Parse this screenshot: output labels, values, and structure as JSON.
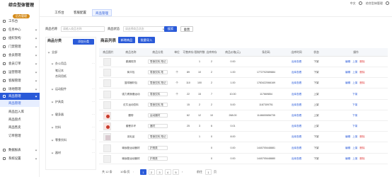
{
  "app": {
    "title": "综合型体管理",
    "badge": "后台管理"
  },
  "sidebar": {
    "items": [
      {
        "label": "工作台",
        "active": false,
        "sub": false,
        "arrow": false
      },
      {
        "label": "任务中心",
        "active": false,
        "sub": false,
        "arrow": true
      },
      {
        "label": "组织架构",
        "active": false,
        "sub": false,
        "arrow": true
      },
      {
        "label": "门禁管理",
        "active": false,
        "sub": false,
        "arrow": true
      },
      {
        "label": "会员管理",
        "active": false,
        "sub": false,
        "arrow": true
      },
      {
        "label": "会员订单",
        "active": false,
        "sub": false,
        "arrow": true
      },
      {
        "label": "运营管理",
        "active": false,
        "sub": false,
        "arrow": true
      },
      {
        "label": "客服管理",
        "active": false,
        "sub": false,
        "arrow": true
      },
      {
        "label": "场地管理",
        "active": false,
        "sub": false,
        "arrow": true
      },
      {
        "label": "商品管理",
        "active": true,
        "sub": false,
        "arrow": true
      },
      {
        "label": "商品管理",
        "active": false,
        "sub": true,
        "arrow": false
      },
      {
        "label": "商品出入库",
        "active": false,
        "sub": false,
        "arrow": false
      },
      {
        "label": "商品盘点",
        "active": false,
        "sub": false,
        "arrow": false
      },
      {
        "label": "商品售卖",
        "active": false,
        "sub": false,
        "arrow": false
      },
      {
        "label": "订单管理",
        "active": false,
        "sub": false,
        "arrow": false
      },
      {
        "label": "数据报表",
        "active": false,
        "sub": false,
        "arrow": true
      },
      {
        "label": "系统设置",
        "active": false,
        "sub": false,
        "arrow": true
      }
    ]
  },
  "topbar": {
    "tabs": [
      {
        "label": "工作台",
        "active": false
      },
      {
        "label": "客服配置",
        "active": false
      },
      {
        "label": "商品管理",
        "active": true
      }
    ],
    "lang": "中文",
    "user": "综合型体管理"
  },
  "search": {
    "name_label": "商品名称",
    "name_placeholder": "请输入商品名称",
    "status_label": "商品状态",
    "status_placeholder": "请选择商品状态",
    "search_button": "搜索",
    "reset_button": "重置"
  },
  "categories": {
    "title": "商品分类",
    "add_button": "添加分类",
    "items": [
      {
        "label": "全部",
        "indent": 0,
        "caret": true
      },
      {
        "label": "办公用品",
        "indent": 1,
        "caret": true
      },
      {
        "label": "笔记本",
        "indent": 2,
        "caret": false
      },
      {
        "label": "合同用纸",
        "indent": 2,
        "caret": false
      },
      {
        "label": "运动配件",
        "indent": 1,
        "caret": true
      },
      {
        "label": "护具类",
        "indent": 1,
        "caret": true
      },
      {
        "label": "健身器",
        "indent": 1,
        "caret": true
      },
      {
        "label": "饮料",
        "indent": 1,
        "caret": true
      },
      {
        "label": "零食饮料",
        "indent": 1,
        "caret": true
      },
      {
        "label": "器材",
        "indent": 1,
        "caret": true
      }
    ]
  },
  "products": {
    "title": "商品列表",
    "add_button": "新增商品",
    "import_button": "批量导入",
    "columns": [
      "商品图片",
      "商品名称",
      "商品分类",
      "单位",
      "可售库存",
      "限制件数",
      "出库库存",
      "商品价格(元)",
      "条形码",
      "出库时间",
      "状态",
      "操作"
    ],
    "rows": [
      {
        "thumb": "",
        "name": "跳绳现货",
        "category": "零食饮料,笔记",
        "unit": "",
        "stock": "",
        "limit": "1",
        "out": "2",
        "price": "0.00",
        "barcode": "",
        "time": "出库查看",
        "status": "下架",
        "ops": [
          "编辑",
          "上架",
          "删除"
        ]
      },
      {
        "thumb": "",
        "name": "商平包",
        "category": "零食饮料,笔",
        "unit": "个",
        "stock": "89",
        "limit": "10",
        "out": "2",
        "price": "1.00",
        "barcode": "1772702089884",
        "time": "出库查看",
        "status": "下架",
        "ops": [
          "编辑",
          "上架",
          "删除"
        ]
      },
      {
        "thumb": "",
        "name": "篮球器材包",
        "category": "零食饮料,笔记",
        "unit": "个",
        "stock": "110",
        "limit": "100",
        "out": "2",
        "price": "1.00",
        "barcode": "1783422066169",
        "time": "出库查看",
        "status": "下架",
        "ops": [
          "编辑",
          "上架",
          "删除"
        ]
      },
      {
        "thumb": "",
        "name": "强力健身器运动",
        "category": "零食饮料",
        "unit": "个",
        "stock": "22",
        "limit": "15",
        "out": "7",
        "price": "10.00",
        "barcode": "117669854",
        "time": "出库查看",
        "status": "上架",
        "ops": [
          "下架"
        ]
      },
      {
        "thumb": "",
        "name": "红牛运动饮料",
        "category": "零食饮料,笔",
        "unit": "",
        "stock": "15",
        "limit": "2",
        "out": "2",
        "price": "5.00",
        "barcode": "1187309751",
        "time": "出库查看",
        "status": "上架",
        "ops": [
          "下架"
        ]
      },
      {
        "thumb": "red",
        "name": "腰带",
        "category": "运动器材",
        "unit": "",
        "stock": "62",
        "limit": "12",
        "out": "10",
        "price": "268.00",
        "barcode": "1146600656735",
        "time": "出库查看",
        "status": "上架",
        "ops": [
          "下架"
        ]
      },
      {
        "thumb": "red",
        "name": "套餐手环",
        "category": "器材",
        "unit": "",
        "stock": "25",
        "limit": "3",
        "out": "6",
        "price": "0.01",
        "barcode": "",
        "time": "出库查看",
        "status": "上架",
        "ops": [
          "下架"
        ]
      },
      {
        "thumb": "pic",
        "name": "羽毛品",
        "category": "零食饮料,笔记",
        "unit": "",
        "stock": "",
        "limit": "1",
        "out": "0",
        "price": "8.00",
        "barcode": "",
        "time": "出库查看",
        "status": "下架",
        "ops": [
          "编辑",
          "上架",
          "删除"
        ]
      },
      {
        "thumb": "",
        "name": "瑜伽垫运动器材",
        "category": "护具类",
        "unit": "",
        "stock": "",
        "limit": "",
        "out": "0",
        "price": "0.00",
        "barcode": "1440705448881",
        "time": "出库查看",
        "status": "下架",
        "ops": [
          "编辑",
          "上架",
          "删除"
        ]
      },
      {
        "thumb": "",
        "name": "瑜伽垫运动器材",
        "category": "护具类",
        "unit": "",
        "stock": "",
        "limit": "",
        "out": "0",
        "price": "0.00",
        "barcode": "1440705448880",
        "time": "出库查看",
        "status": "下架",
        "ops": [
          "编辑",
          "上架",
          "删除"
        ]
      }
    ]
  },
  "pager": {
    "total": "共 12 条",
    "per_page": "10条/页",
    "pages": [
      "1",
      "2",
      "3",
      "4",
      "5"
    ],
    "current": "1",
    "goto_label": "前往",
    "goto_value": "1",
    "goto_unit": "页"
  },
  "colors": {
    "accent": "#2a5ad8",
    "danger": "#e04040",
    "badge": "#d48b1b"
  }
}
